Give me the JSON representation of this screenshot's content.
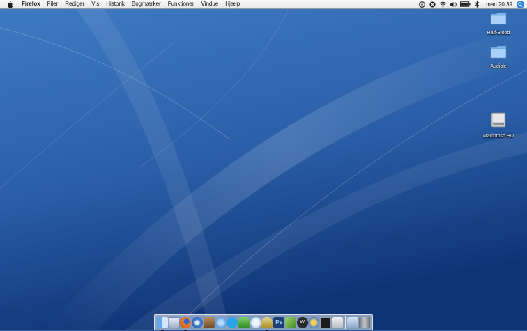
{
  "menubar": {
    "app_name": "Firefox",
    "items": [
      "Filer",
      "Rediger",
      "Vis",
      "Historik",
      "Bogmærker",
      "Funktioner",
      "Vindue",
      "Hjælp"
    ],
    "clock": "man 20.39",
    "status_icons": [
      "sync-icon",
      "close-circle-icon",
      "wifi-icon",
      "volume-icon",
      "battery-icon",
      "bluetooth-icon"
    ]
  },
  "desktop": {
    "icons": [
      {
        "label": "Half-Blood",
        "icon": "folder-icon"
      },
      {
        "label": "Audible",
        "icon": "folder-icon"
      },
      {
        "label": "Macintosh HD",
        "icon": "hard-drive-icon"
      }
    ]
  },
  "dock": {
    "apps": [
      "finder-icon",
      "mail-icon",
      "firefox-icon",
      "safari-icon",
      "preview-icon",
      "itunes-icon",
      "skype-icon",
      "adium-icon",
      "ichat-icon",
      "microphone-icon",
      "photoshop-icon",
      "textmate-icon",
      "wikipedia-icon",
      "transmit-icon",
      "terminal-icon",
      "system-preferences-icon"
    ],
    "stacks": [
      "applications-stack-icon",
      "trash-icon"
    ],
    "photoshop_label": "Ps",
    "wiki_label": "W"
  },
  "colors": {
    "wallpaper_top": "#3f7cc4",
    "wallpaper_bottom": "#0f3476",
    "accent": "#2f7fdc"
  }
}
